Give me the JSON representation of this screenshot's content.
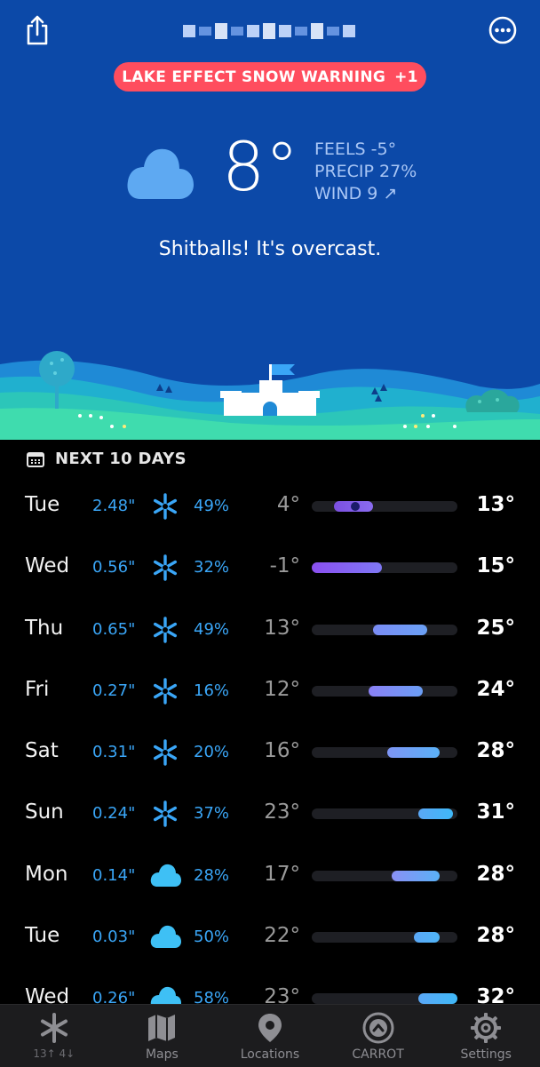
{
  "header": {
    "warning_label": "LAKE EFFECT SNOW WARNING",
    "warning_extra": "+1"
  },
  "current": {
    "temp": "8°",
    "feels": "FEELS -5°",
    "precip": "PRECIP 27%",
    "wind": "WIND 9 ↗",
    "tagline": "Shitballs! It's overcast.",
    "icon": "cloud-icon"
  },
  "forecast": {
    "title": "NEXT 10 DAYS",
    "days": [
      {
        "day": "Tue",
        "precip": "2.48\"",
        "icon": "snowflake-icon",
        "chance": "49%",
        "low": "4°",
        "high": "13°",
        "range_start": 0.15,
        "range_end": 0.42,
        "color_from": "#7b4fe0",
        "color_to": "#8a6cf0",
        "current": 0.27
      },
      {
        "day": "Wed",
        "precip": "0.56\"",
        "icon": "snowflake-icon",
        "chance": "32%",
        "low": "-1°",
        "high": "15°",
        "range_start": 0.0,
        "range_end": 0.48,
        "color_from": "#8a4ff0",
        "color_to": "#7f78f5"
      },
      {
        "day": "Thu",
        "precip": "0.65\"",
        "icon": "snowflake-icon",
        "chance": "49%",
        "low": "13°",
        "high": "25°",
        "range_start": 0.42,
        "range_end": 0.79,
        "color_from": "#7a8cf5",
        "color_to": "#6aa0f5"
      },
      {
        "day": "Fri",
        "precip": "0.27\"",
        "icon": "snowflake-icon",
        "chance": "16%",
        "low": "12°",
        "high": "24°",
        "range_start": 0.39,
        "range_end": 0.76,
        "color_from": "#8a80f5",
        "color_to": "#6a9ef5"
      },
      {
        "day": "Sat",
        "precip": "0.31\"",
        "icon": "snowflake-icon",
        "chance": "20%",
        "low": "16°",
        "high": "28°",
        "range_start": 0.52,
        "range_end": 0.88,
        "color_from": "#7e95f5",
        "color_to": "#5ab1f7"
      },
      {
        "day": "Sun",
        "precip": "0.24\"",
        "icon": "snowflake-icon",
        "chance": "37%",
        "low": "23°",
        "high": "31°",
        "range_start": 0.73,
        "range_end": 0.97,
        "color_from": "#5aa8f7",
        "color_to": "#3fb8f7"
      },
      {
        "day": "Mon",
        "precip": "0.14\"",
        "icon": "cloud-icon",
        "chance": "28%",
        "low": "17°",
        "high": "28°",
        "range_start": 0.55,
        "range_end": 0.88,
        "color_from": "#8a90f5",
        "color_to": "#5ab1f7"
      },
      {
        "day": "Tue",
        "precip": "0.03\"",
        "icon": "cloud-icon",
        "chance": "50%",
        "low": "22°",
        "high": "28°",
        "range_start": 0.7,
        "range_end": 0.88,
        "color_from": "#5aa8f7",
        "color_to": "#4fb5f7"
      },
      {
        "day": "Wed",
        "precip": "0.26\"",
        "icon": "cloud-icon",
        "chance": "58%",
        "low": "23°",
        "high": "32°",
        "range_start": 0.73,
        "range_end": 1.0,
        "color_from": "#5aa8f7",
        "color_to": "#3fb8f7"
      }
    ]
  },
  "tabbar": {
    "tabs": [
      {
        "label": "13↑ 4↓",
        "icon": "snowflake-icon"
      },
      {
        "label": "Maps",
        "icon": "map-icon"
      },
      {
        "label": "Locations",
        "icon": "location-pin-icon"
      },
      {
        "label": "CARROT",
        "icon": "carrot-logo-icon"
      },
      {
        "label": "Settings",
        "icon": "gear-icon"
      }
    ]
  }
}
